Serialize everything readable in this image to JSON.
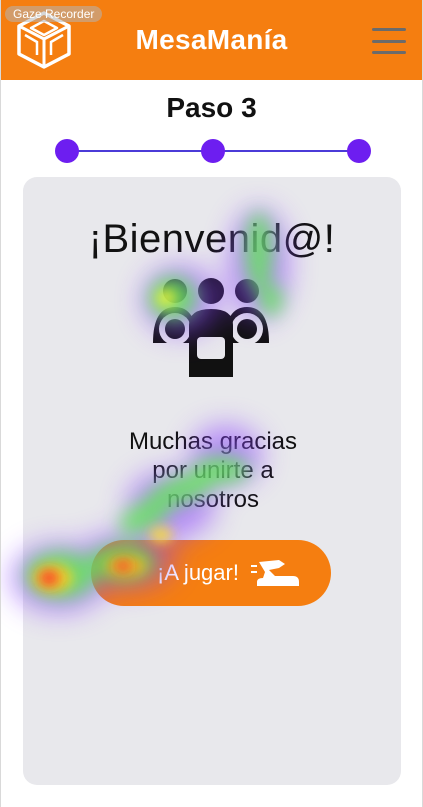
{
  "watermark": {
    "text": "Gaze  Recorder"
  },
  "header": {
    "title": "MesaManía",
    "logo_icon": "dice-cube-logo",
    "menu_icon": "hamburger-menu-icon",
    "background_color": "#f57e10"
  },
  "stepper": {
    "title": "Paso 3",
    "steps": 3,
    "current_step": 3,
    "dot_color": "#6d1ef0"
  },
  "card": {
    "welcome": "¡Bienvenid@!",
    "illustration_icon": "group-of-people-icon",
    "thanks": [
      "Muchas gracias",
      "por unirte a",
      "nosotros"
    ],
    "play_button": {
      "label": "¡A jugar!",
      "icon": "game-piece-icon",
      "color": "#f57e10"
    }
  },
  "overlay": {
    "type": "gaze-heatmap"
  }
}
